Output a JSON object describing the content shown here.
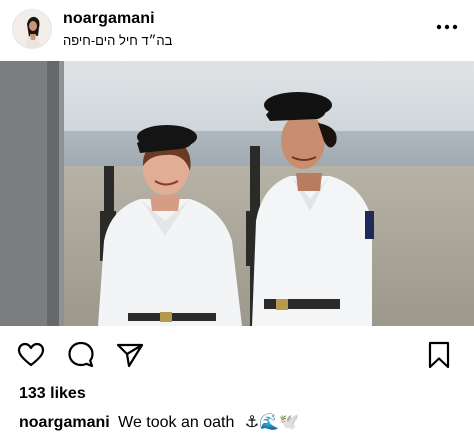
{
  "post": {
    "username": "noargamani",
    "location": "בה״ד חיל הים-חיפה",
    "likes": "133 likes",
    "caption_user": "noargamani",
    "caption_text": "We took an oath",
    "caption_emojis": "⚓🌊🕊️"
  },
  "icons": {
    "more": "more-options-icon",
    "like": "heart-icon",
    "comment": "comment-icon",
    "share": "paper-plane-icon",
    "save": "bookmark-icon"
  }
}
